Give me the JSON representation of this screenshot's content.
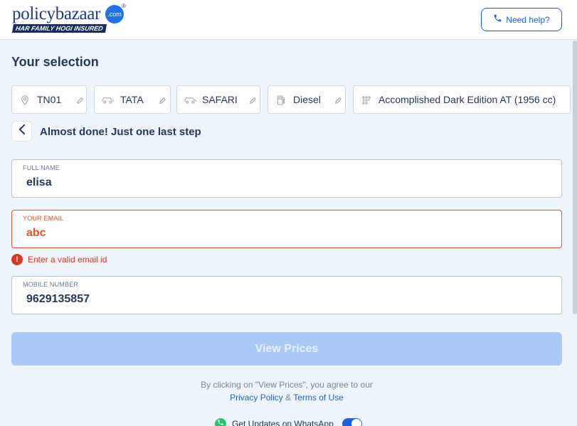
{
  "header": {
    "logo_text": "policybazaar",
    "logo_com": ".com",
    "logo_reg": "®",
    "logo_tagline": "HAR FAMILY HOGI INSURED",
    "help_label": "Need help?"
  },
  "selection": {
    "title": "Your selection",
    "chips": [
      {
        "icon": "location-pin-icon",
        "label": "TN01"
      },
      {
        "icon": "car-icon",
        "label": "TATA"
      },
      {
        "icon": "car-icon",
        "label": "SAFARI"
      },
      {
        "icon": "fuel-pump-icon",
        "label": "Diesel"
      },
      {
        "icon": "gearbox-icon",
        "label": "Accomplished Dark Edition AT (1956 cc)"
      }
    ]
  },
  "step": {
    "title": "Almost done! Just one last step"
  },
  "form": {
    "full_name": {
      "label": "FULL NAME",
      "value": "elisa"
    },
    "email": {
      "label": "YOUR EMAIL",
      "value": "abc",
      "error": "Enter a valid email id",
      "error_icon": "!"
    },
    "mobile": {
      "label": "MOBILE NUMBER",
      "value": "9629135857"
    }
  },
  "cta": {
    "label": "View Prices"
  },
  "consent": {
    "text": "By clicking on \"View Prices\", you agree to our",
    "privacy": "Privacy Policy",
    "amp": "&",
    "terms": "Terms of Use"
  },
  "whatsapp": {
    "label": "Get Updates on WhatsApp",
    "enabled": true
  },
  "colors": {
    "brand": "#1f3a8a",
    "accent": "#1b62d7",
    "error": "#d9391f",
    "cta_disabled": "#a9c9f8",
    "background": "#eef4fb"
  }
}
